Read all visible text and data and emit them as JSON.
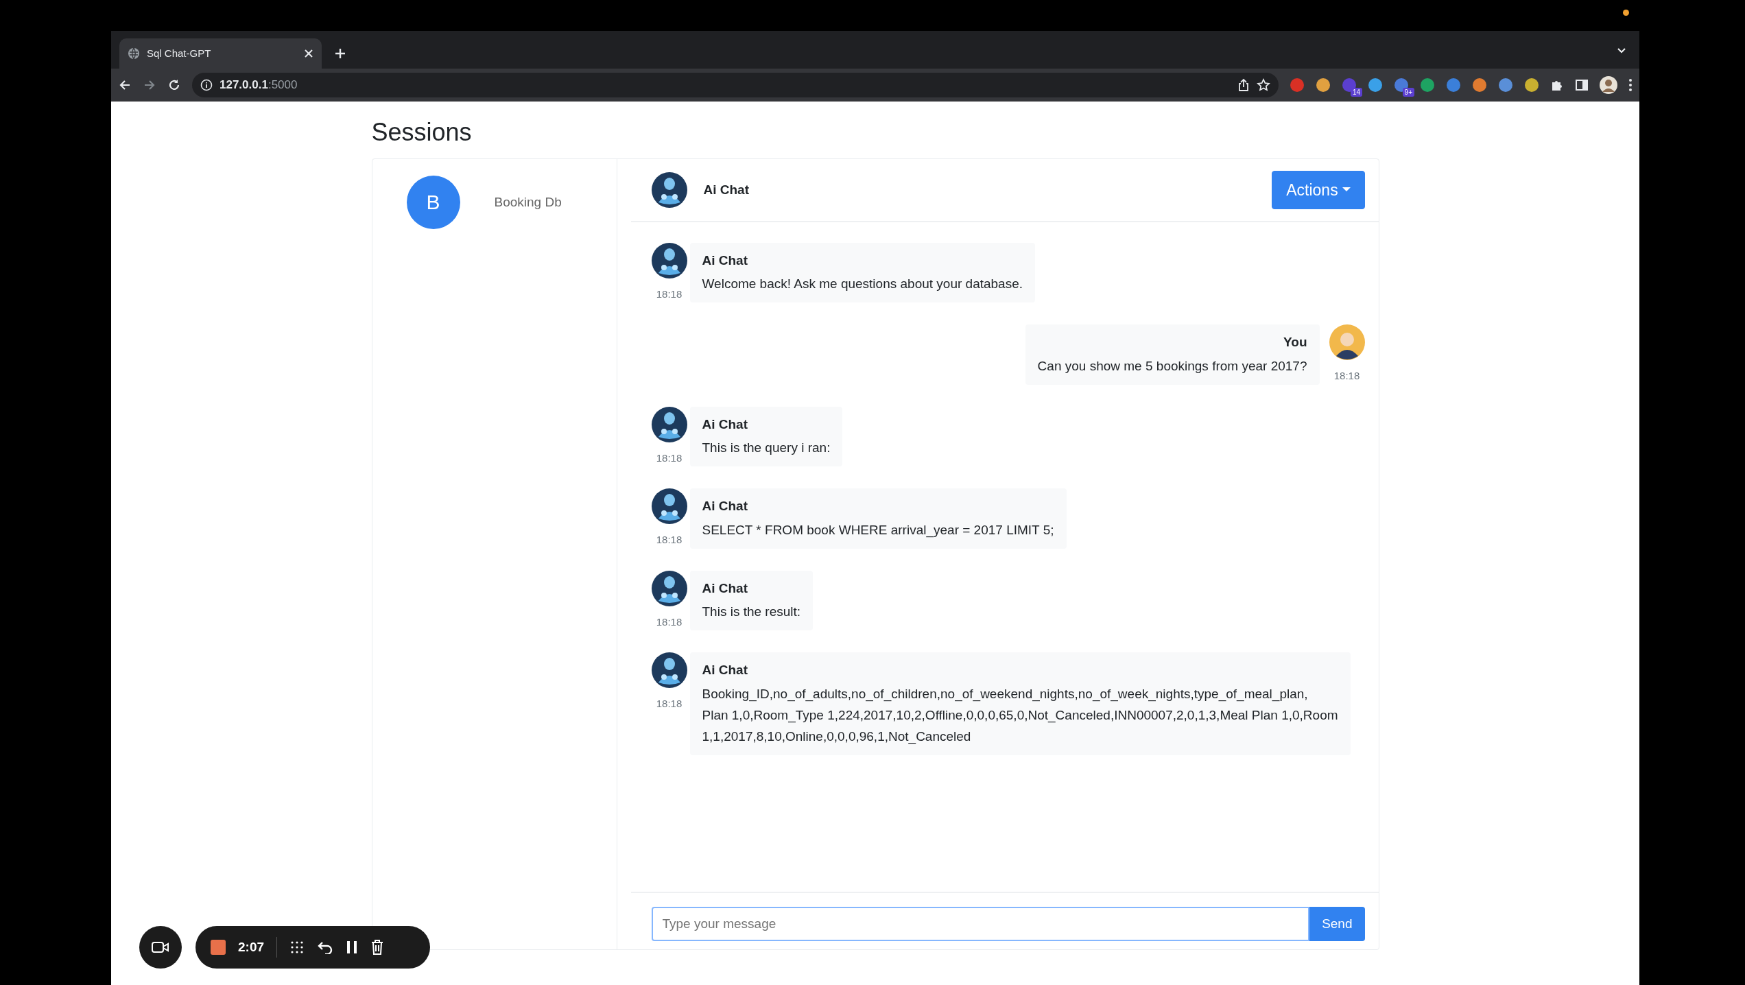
{
  "browser": {
    "tab_title": "Sql Chat-GPT",
    "url_host": "127.0.0.1",
    "url_port": ":5000",
    "extensions": [
      {
        "color": "#d93025"
      },
      {
        "color": "#e0a040"
      },
      {
        "color": "#5b3fd0",
        "badge": "14"
      },
      {
        "color": "#3aa0e8"
      },
      {
        "color": "#4a7ad8",
        "badge": "9+"
      },
      {
        "color": "#1ea362"
      },
      {
        "color": "#3b7fd9"
      },
      {
        "color": "#e07b30"
      },
      {
        "color": "#5a8fd8"
      },
      {
        "color": "#c9b030"
      }
    ]
  },
  "page": {
    "title": "Sessions"
  },
  "sessions": [
    {
      "initial": "B",
      "name": "Booking Db"
    }
  ],
  "chat": {
    "header_name": "Ai Chat",
    "actions_label": "Actions",
    "messages": [
      {
        "kind": "bot",
        "name": "Ai Chat",
        "time": "18:18",
        "lines": [
          "Welcome back! Ask me questions about your database."
        ]
      },
      {
        "kind": "user",
        "name": "You",
        "time": "18:18",
        "lines": [
          "Can you show me 5 bookings from year 2017?"
        ]
      },
      {
        "kind": "bot",
        "name": "Ai Chat",
        "time": "18:18",
        "lines": [
          "This is the query i ran:"
        ]
      },
      {
        "kind": "bot",
        "name": "Ai Chat",
        "time": "18:18",
        "lines": [
          "SELECT * FROM book WHERE arrival_year = 2017 LIMIT 5;"
        ]
      },
      {
        "kind": "bot",
        "name": "Ai Chat",
        "time": "18:18",
        "lines": [
          "This is the result:"
        ]
      },
      {
        "kind": "bot",
        "name": "Ai Chat",
        "time": "18:18",
        "lines": [
          "Booking_ID,no_of_adults,no_of_children,no_of_weekend_nights,no_of_week_nights,type_of_meal_plan,",
          "Plan 1,0,Room_Type 1,224,2017,10,2,Offline,0,0,0,65,0,Not_Canceled,INN00007,2,0,1,3,Meal Plan 1,0,Room",
          "1,1,2017,8,10,Online,0,0,0,96,1,Not_Canceled"
        ]
      }
    ],
    "input": {
      "placeholder": "Type your message"
    },
    "send_label": "Send"
  },
  "recorder": {
    "time": "2:07"
  }
}
